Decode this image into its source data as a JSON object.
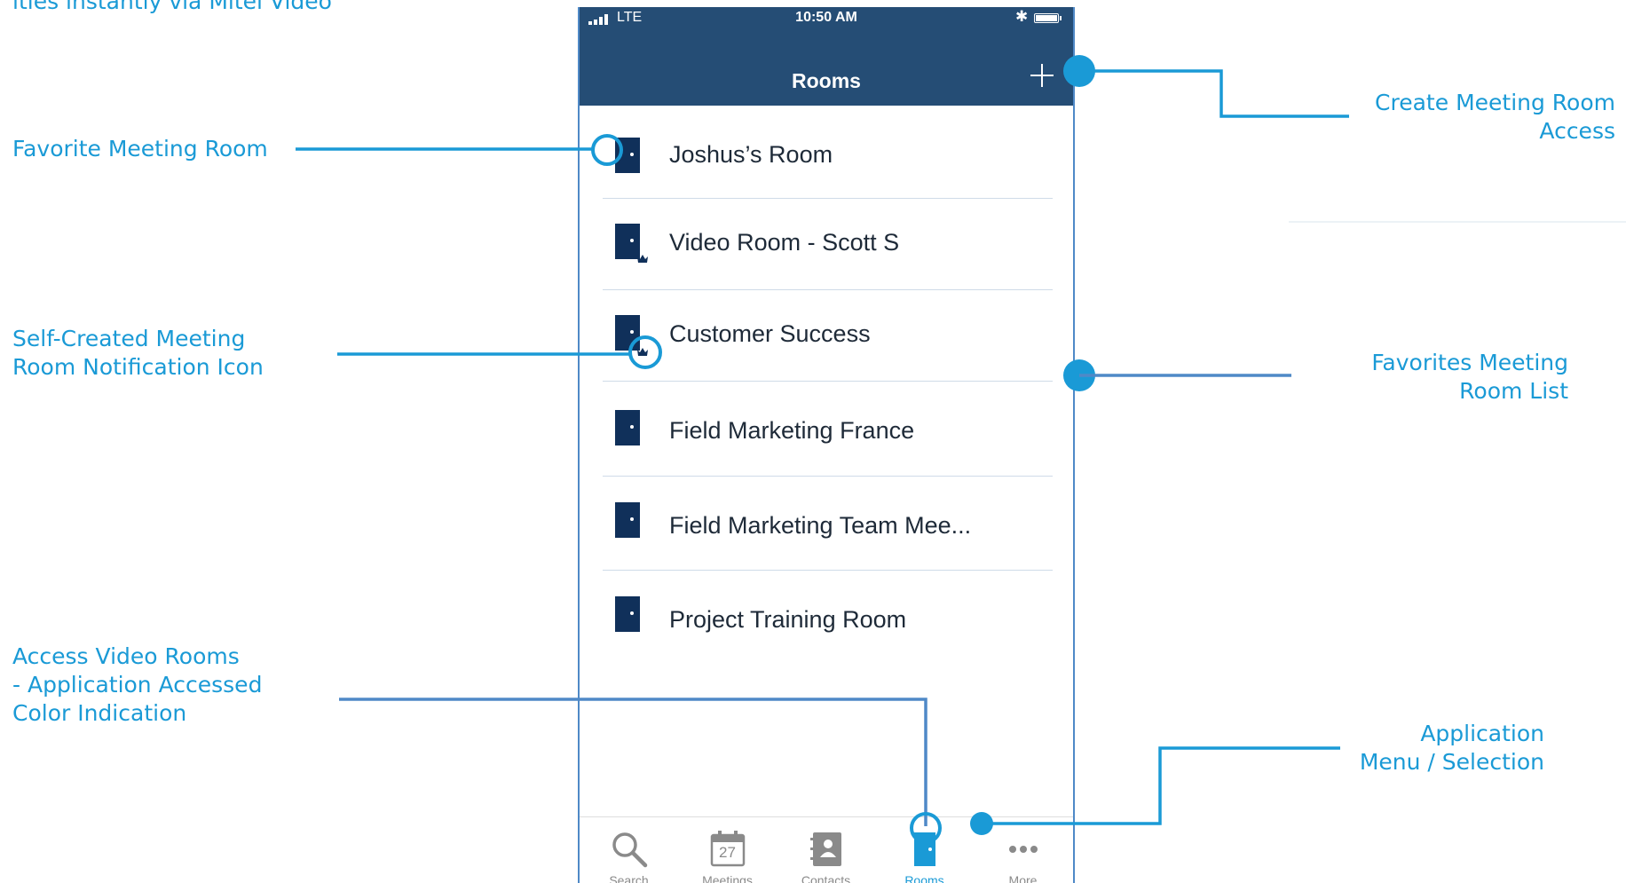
{
  "callouts": {
    "top_partial": "ities instantly via Mitel Video",
    "favorite_room": "Favorite Meeting Room",
    "self_created_line1": "Self-Created Meeting",
    "self_created_line2": "Room Notification Icon",
    "access_rooms_line1": "Access Video Rooms",
    "access_rooms_line2": "- Application Accessed",
    "access_rooms_line3": "Color Indication",
    "create_access_line1": "Create Meeting Room",
    "create_access_line2": "Access",
    "favorites_list_line1": "Favorites Meeting",
    "favorites_list_line2": "Room List",
    "app_menu_line1": "Application",
    "app_menu_line2": "Menu / Selection"
  },
  "status_bar": {
    "carrier": "LTE",
    "time": "10:50 AM",
    "bluetooth_icon": "bluetooth-icon",
    "battery_icon": "battery-icon",
    "signal_icon": "signal-bars-icon"
  },
  "header": {
    "title": "Rooms",
    "add_icon": "plus-icon"
  },
  "rooms": [
    {
      "name": "Joshus’s Room",
      "self_created": false
    },
    {
      "name": "Video Room - Scott S",
      "self_created": true
    },
    {
      "name": "Customer Success",
      "self_created": true
    },
    {
      "name": "Field Marketing France",
      "self_created": false
    },
    {
      "name": "Field Marketing Team Mee...",
      "self_created": false
    },
    {
      "name": "Project Training Room",
      "self_created": false
    }
  ],
  "tabs": [
    {
      "label": "Search",
      "icon": "magnifier-icon",
      "active": false
    },
    {
      "label": "Meetings",
      "icon": "calendar-icon",
      "active": false,
      "calendar_day": "27"
    },
    {
      "label": "Contacts",
      "icon": "contacts-book-icon",
      "active": false
    },
    {
      "label": "Rooms",
      "icon": "door-icon",
      "active": true
    },
    {
      "label": "More",
      "icon": "ellipsis-icon",
      "active": false
    }
  ],
  "colors": {
    "header_bg": "#254d75",
    "accent": "#1a9ad6",
    "door": "#10305a",
    "callout_line": "#1a9ad6"
  }
}
